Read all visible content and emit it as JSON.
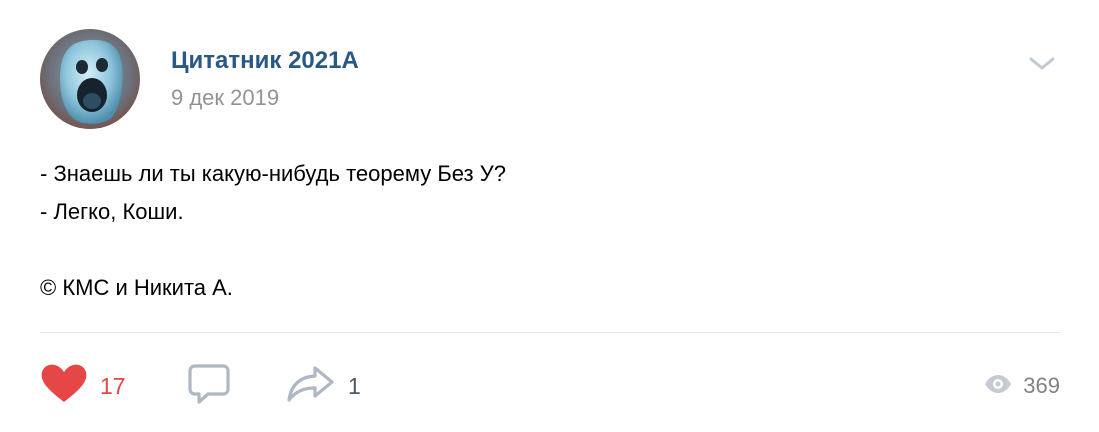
{
  "post": {
    "author": "Цитатник 2021А",
    "date": "9 дек 2019",
    "text_lines": [
      "- Знаешь ли ты какую-нибудь теорему Без У?",
      "- Легко, Коши.",
      "",
      "© КМС и Никита А."
    ]
  },
  "actions": {
    "likes": "17",
    "shares": "1",
    "views": "369"
  },
  "icons": {
    "like": "heart-icon",
    "comment": "comment-bubble-icon",
    "share": "share-arrow-icon",
    "views": "eye-icon",
    "menu": "chevron-down-icon"
  },
  "colors": {
    "author_link": "#2a5885",
    "like_active": "#e64646",
    "muted": "#939393",
    "icon_gray": "#aeb7c2"
  }
}
